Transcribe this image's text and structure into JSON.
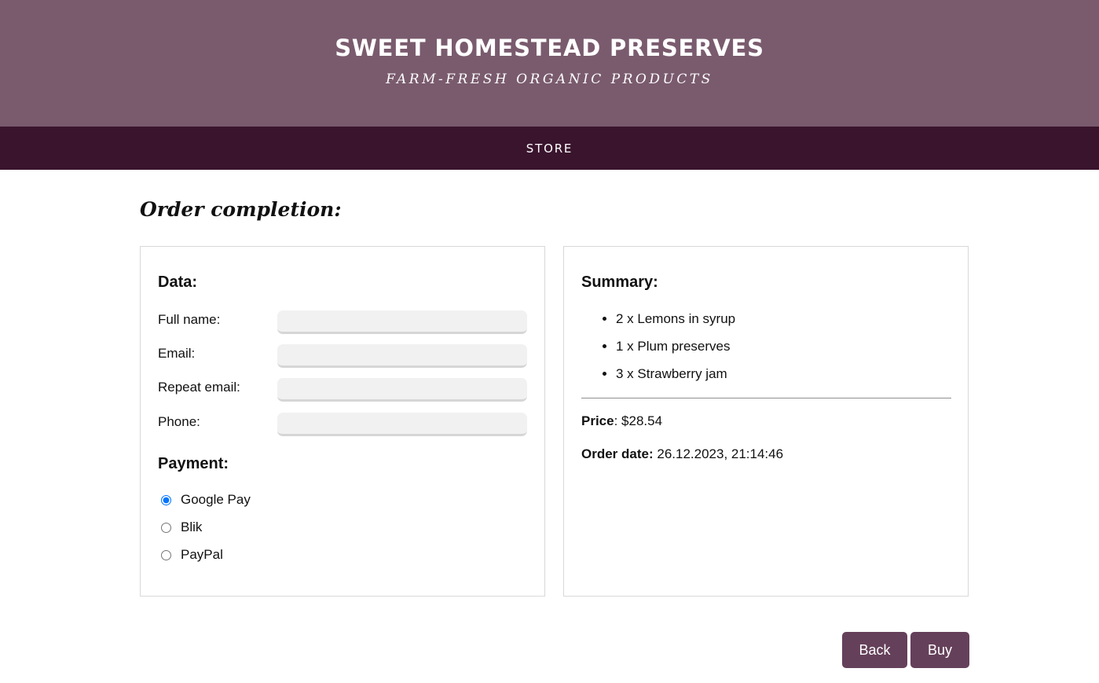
{
  "header": {
    "title": "SWEET HOMESTEAD PRESERVES",
    "subtitle": "FARM-FRESH ORGANIC PRODUCTS"
  },
  "nav": {
    "store_label": "STORE"
  },
  "page": {
    "title": "Order completion:"
  },
  "data_panel": {
    "heading": "Data:",
    "fields": [
      {
        "label": "Full name:",
        "value": ""
      },
      {
        "label": "Email:",
        "value": ""
      },
      {
        "label": "Repeat email:",
        "value": ""
      },
      {
        "label": "Phone:",
        "value": ""
      }
    ],
    "payment_heading": "Payment:",
    "payment_options": [
      {
        "label": "Google Pay",
        "selected": true
      },
      {
        "label": "Blik",
        "selected": false
      },
      {
        "label": "PayPal",
        "selected": false
      }
    ]
  },
  "summary_panel": {
    "heading": "Summary:",
    "items": [
      "2 x Lemons in syrup",
      "1 x Plum preserves",
      "3 x Strawberry jam"
    ],
    "price_label": "Price",
    "price_value": ": $28.54",
    "order_date_label": "Order date:",
    "order_date_value": " 26.12.2023, 21:14:46"
  },
  "actions": {
    "back_label": "Back",
    "buy_label": "Buy"
  },
  "colors": {
    "header_bg": "#7a5b6e",
    "nav_bg": "#3a142d",
    "button_bg": "#65405a"
  }
}
